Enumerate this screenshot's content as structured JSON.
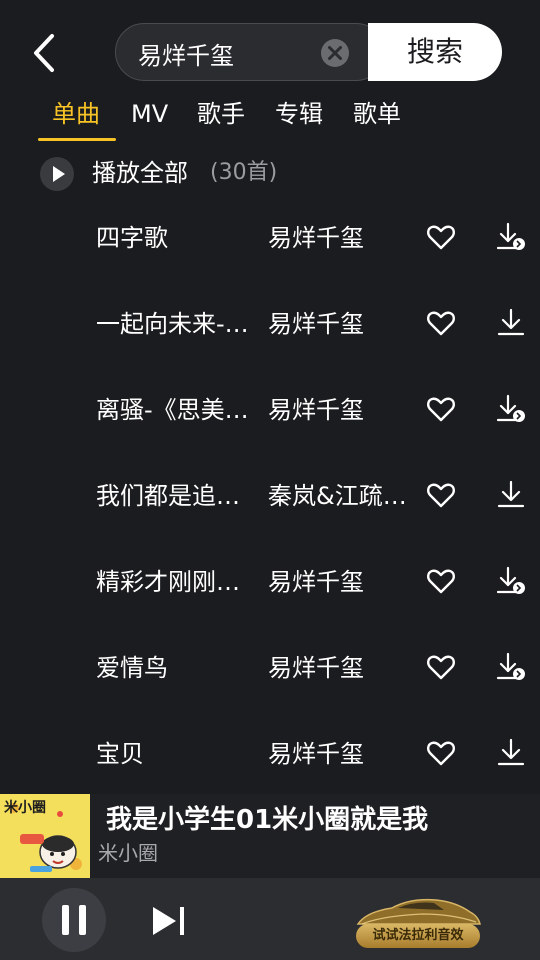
{
  "search": {
    "query": "易烊千玺",
    "button_label": "搜索"
  },
  "tabs": [
    {
      "label": "单曲",
      "active": true
    },
    {
      "label": "MV",
      "active": false
    },
    {
      "label": "歌手",
      "active": false
    },
    {
      "label": "专辑",
      "active": false
    },
    {
      "label": "歌单",
      "active": false
    }
  ],
  "play_all": {
    "label": "播放全部",
    "count": "(30首)"
  },
  "songs": [
    {
      "title": "四字歌",
      "artist": "易烊千玺",
      "download_icon": "download-badge-icon"
    },
    {
      "title": "一起向未来-…",
      "artist": "易烊千玺",
      "download_icon": "download-icon"
    },
    {
      "title": "离骚-《思美…",
      "artist": "易烊千玺",
      "download_icon": "download-badge-icon"
    },
    {
      "title": "我们都是追…",
      "artist": "秦岚&江疏…",
      "download_icon": "download-icon"
    },
    {
      "title": "精彩才刚刚…",
      "artist": "易烊千玺",
      "download_icon": "download-badge-icon"
    },
    {
      "title": "爱情鸟",
      "artist": "易烊千玺",
      "download_icon": "download-badge-icon"
    },
    {
      "title": "宝贝",
      "artist": "易烊千玺",
      "download_icon": "download-icon"
    }
  ],
  "now_playing": {
    "title": "我是小学生01米小圈就是我",
    "artist": "米小圈",
    "cover_text": "米小圈"
  },
  "player": {
    "ferrari_label": "试试法拉利音效"
  },
  "colors": {
    "accent": "#f7c326",
    "background": "#1b1c1f",
    "control_bar": "#2c2d31"
  }
}
